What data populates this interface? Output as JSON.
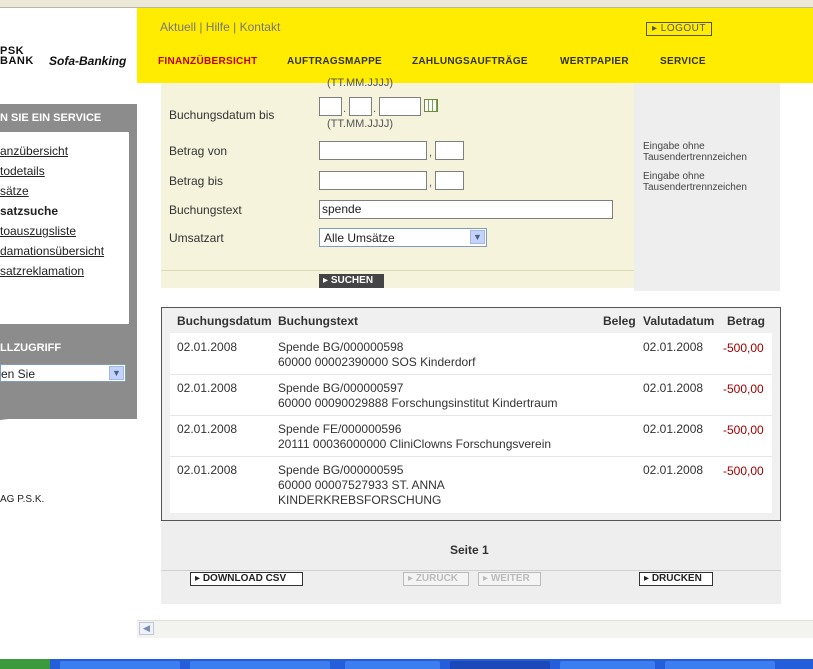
{
  "brand": {
    "logo_line1": "PSK",
    "logo_line2": "BANK",
    "product": "Sofa-Banking",
    "copyright": "AG P.S.K."
  },
  "header": {
    "top_links": "Aktuell | Hilfe | Kontakt",
    "logout": "LOGOUT",
    "nav": [
      "FINANZÜBERSICHT",
      "AUFTRAGSMAPPE",
      "ZAHLUNGSAUFTRÄGE",
      "WERTPAPIER",
      "SERVICE"
    ],
    "active_nav": "FINANZÜBERSICHT"
  },
  "sidebar": {
    "service_title": "N SIE EIN SERVICE",
    "items": [
      "anzübersicht",
      "todetails",
      "sätze",
      "satzsuche",
      "toauszugsliste",
      "damationsübersicht",
      "satzreklamation"
    ],
    "active_item": "satzsuche",
    "schnell_title": "LLZUGRIFF",
    "schnell_value": "en Sie"
  },
  "form": {
    "date_hint_top": "(TT.MM.JJJJ)",
    "date_to_label": "Buchungsdatum bis",
    "date_to_hint": "(TT.MM.JJJJ)",
    "amount_from_label": "Betrag von",
    "amount_to_label": "Betrag bis",
    "text_label": "Buchungstext",
    "text_value": "spende",
    "type_label": "Umsatzart",
    "type_value": "Alle Umsätze",
    "search_button": "SUCHEN",
    "hint_amount_from": [
      "Eingabe ohne",
      "Tausendertrennzeichen"
    ],
    "hint_amount_to": [
      "Eingabe ohne",
      "Tausendertrennzeichen"
    ]
  },
  "results": {
    "columns": {
      "date": "Buchungsdatum",
      "text": "Buchungstext",
      "beleg": "Beleg",
      "valuta": "Valutadatum",
      "amount": "Betrag"
    },
    "rows": [
      {
        "date": "02.01.2008",
        "text": [
          "Spende BG/000000598",
          "60000 00002390000 SOS Kinderdorf"
        ],
        "valuta": "02.01.2008",
        "amount": "-500,00"
      },
      {
        "date": "02.01.2008",
        "text": [
          "Spende BG/000000597",
          "60000 00090029888 Forschungsinstitut Kindertraum"
        ],
        "valuta": "02.01.2008",
        "amount": "-500,00"
      },
      {
        "date": "02.01.2008",
        "text": [
          "Spende FE/000000596",
          "20111 00036000000 CliniClowns Forschungsverein"
        ],
        "valuta": "02.01.2008",
        "amount": "-500,00"
      },
      {
        "date": "02.01.2008",
        "text": [
          "Spende BG/000000595",
          "60000 00007527933 ST. ANNA",
          "KINDERKREBSFORSCHUNG"
        ],
        "valuta": "02.01.2008",
        "amount": "-500,00"
      }
    ]
  },
  "pager": {
    "page_label": "Seite 1",
    "download": "DOWNLOAD CSV",
    "back": "ZURÜCK",
    "next": "WEITER",
    "print": "DRUCKEN"
  },
  "colors": {
    "header_yellow": "#ffec00",
    "active_red": "#c00000",
    "amount_red": "#a00000",
    "sidebar_grey": "#8c8c8c"
  }
}
